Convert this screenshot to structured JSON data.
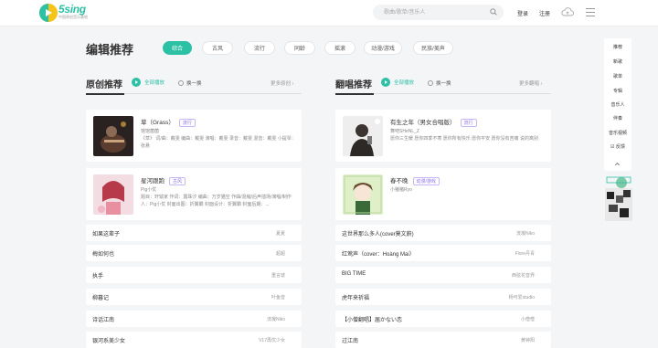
{
  "header": {
    "logo_text": "5sing",
    "logo_sub": "中国原创音乐基地",
    "search_placeholder": "歌曲/歌单/音乐人",
    "login": "登录",
    "register": "注册"
  },
  "section": {
    "title": "编辑推荐",
    "tabs": [
      "综合",
      "古风",
      "流行",
      "同龄",
      "摇滚",
      "动漫/游戏",
      "民族/美声"
    ]
  },
  "original": {
    "heading": "原创推荐",
    "play_all": "全部播放",
    "shuffle": "换一换",
    "more": "更多原创 ›",
    "cards": [
      {
        "title": "草（Grass）",
        "tag": "流行",
        "artist": "馆馆菌菌",
        "desc": "《草》 词/曲：戴雯 编曲：戴雯 演唱：戴雯 录音：戴雯 混音：戴雯 小提琴：张悬"
      },
      {
        "title": "星河跟跑",
        "tag": "古风",
        "artist": "Pig小优",
        "desc": "题目：轩辕家 作词：露珠汐 编曲：万岁猫空 作曲/混缩/后声插场/演唱/制作人：Pig小优 封面出图：折翼霸 封面设计：折翼霸 封面后期：..."
      }
    ],
    "list": [
      {
        "title": "如果这辈子",
        "artist": "夏夏"
      },
      {
        "title": "梅如何也",
        "artist": "超超"
      },
      {
        "title": "执手",
        "artist": "重言琥"
      },
      {
        "title": "柳暮记",
        "artist": "叶鱼音"
      },
      {
        "title": "诗话江南",
        "artist": "流凝Niko"
      },
      {
        "title": "银河系美少女",
        "artist": "V17再优少女"
      }
    ]
  },
  "cover": {
    "heading": "翻唱推荐",
    "play_all": "全部播放",
    "shuffle": "换一换",
    "more": "更多翻唱 ›",
    "cards": [
      {
        "title": "有生之年（男女合唱版）",
        "tag": "流行",
        "artist": "舞吧SHeNL_Z",
        "desc": "愿你三生暖 愿你四季不寒 愿你所有快乐 愿你平安 愿你没有苦痛 说的离别"
      },
      {
        "title": "春不晚",
        "tag": "动漫/游戏",
        "artist": "小猪猪Ryo",
        "desc": ""
      }
    ],
    "list": [
      {
        "title": "这世界那么多人(cover莫文蔚)",
        "artist": "流凝Niko"
      },
      {
        "title": "红莺声（cover：Hoàng Mai）",
        "artist": "Flore丹青"
      },
      {
        "title": "BIG TIME",
        "artist": "西弦花音界"
      },
      {
        "title": "虎年来祈福",
        "artist": "杨可爱studio"
      },
      {
        "title": "【小僧翻唱】届かない恋",
        "artist": "小僧僧"
      },
      {
        "title": "过江南",
        "artist": "黄钟阳"
      }
    ]
  },
  "side_nav": {
    "items": [
      "推荐",
      "新歌",
      "歌单",
      "专辑",
      "音乐人",
      "伴奏",
      "音乐视频",
      "反馈"
    ]
  },
  "colors": {
    "accent": "#2cc0a4",
    "tag_purple": "#8a6de9"
  }
}
